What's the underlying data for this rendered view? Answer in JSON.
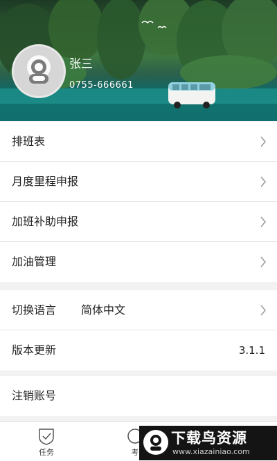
{
  "profile": {
    "name": "张三",
    "phone": "0755-666661"
  },
  "menu_group1": [
    {
      "label": "排班表"
    },
    {
      "label": "月度里程申报"
    },
    {
      "label": "加班补助申报"
    },
    {
      "label": "加油管理"
    }
  ],
  "menu_group2": {
    "language_label": "切换语言",
    "language_value": "简体中文",
    "version_label": "版本更新",
    "version_value": "3.1.1"
  },
  "menu_group3": {
    "logout_label": "注销账号"
  },
  "tabbar": {
    "tab1_label": "任务",
    "tab2_label": "考"
  },
  "watermark": {
    "title": "下载鸟资源",
    "url": "www.xiazainiao.com"
  },
  "colors": {
    "divider": "#e7e7e7",
    "background": "#f2f2f2",
    "chevron": "#999999"
  }
}
